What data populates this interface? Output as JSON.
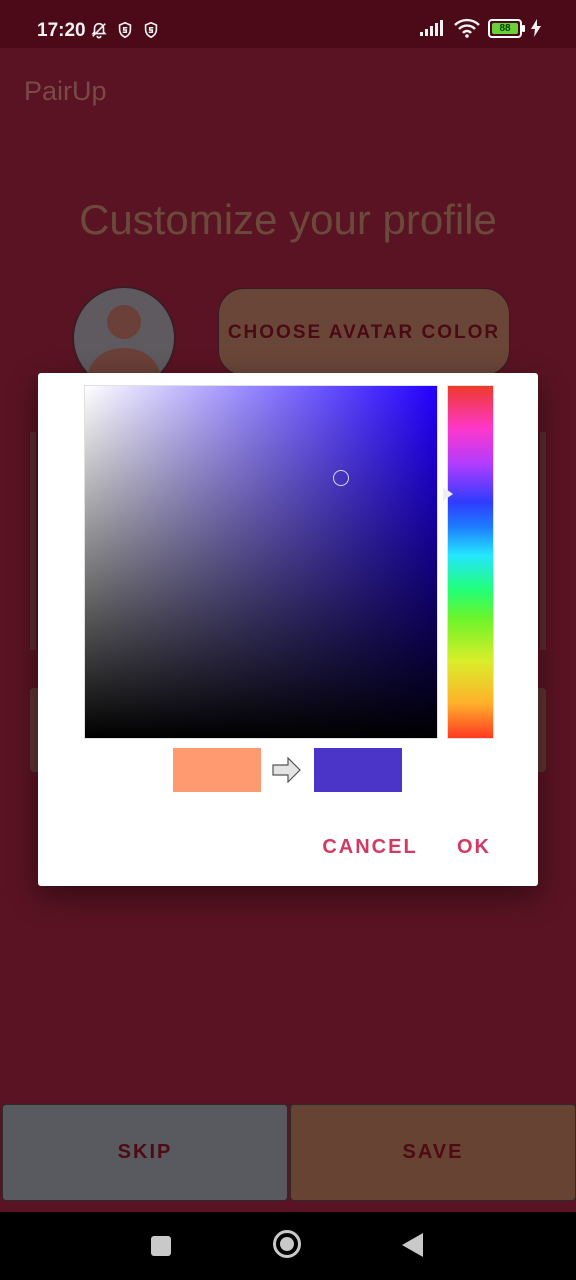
{
  "status_bar": {
    "time": "17:20",
    "battery_level": "88",
    "icons": [
      "mute-bell-icon",
      "vpn-shield-icon",
      "vpn-shield-icon",
      "signal-icon",
      "wifi-icon",
      "battery-icon",
      "charging-bolt-icon"
    ]
  },
  "app": {
    "title": "PairUp",
    "headline": "Customize your profile",
    "choose_avatar_color_label": "CHOOSE AVATAR COLOR",
    "skip_label": "SKIP",
    "save_label": "SAVE"
  },
  "color_dialog": {
    "hue_color": "#2200FF",
    "old_color": "#FF9A70",
    "new_color": "#4A35C8",
    "cancel_label": "CANCEL",
    "ok_label": "OK"
  },
  "nav_bar": {
    "buttons": [
      "recent-apps",
      "home",
      "back"
    ]
  },
  "colors": {
    "scrim_background": "#5A1322",
    "accent": "#D23A63"
  }
}
